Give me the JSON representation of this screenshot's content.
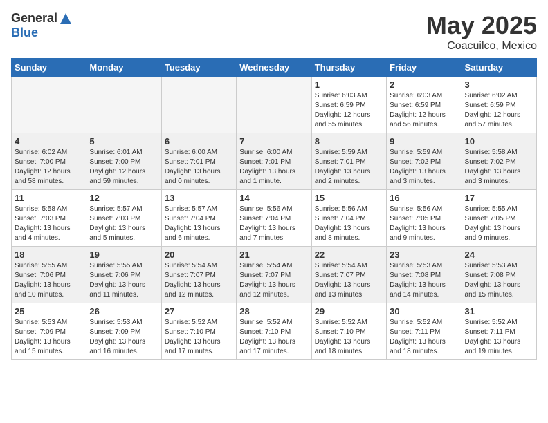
{
  "header": {
    "logo_general": "General",
    "logo_blue": "Blue",
    "month_year": "May 2025",
    "location": "Coacuilco, Mexico"
  },
  "days_of_week": [
    "Sunday",
    "Monday",
    "Tuesday",
    "Wednesday",
    "Thursday",
    "Friday",
    "Saturday"
  ],
  "weeks": [
    [
      {
        "day": "",
        "info": ""
      },
      {
        "day": "",
        "info": ""
      },
      {
        "day": "",
        "info": ""
      },
      {
        "day": "",
        "info": ""
      },
      {
        "day": "1",
        "info": "Sunrise: 6:03 AM\nSunset: 6:59 PM\nDaylight: 12 hours and 55 minutes."
      },
      {
        "day": "2",
        "info": "Sunrise: 6:03 AM\nSunset: 6:59 PM\nDaylight: 12 hours and 56 minutes."
      },
      {
        "day": "3",
        "info": "Sunrise: 6:02 AM\nSunset: 6:59 PM\nDaylight: 12 hours and 57 minutes."
      }
    ],
    [
      {
        "day": "4",
        "info": "Sunrise: 6:02 AM\nSunset: 7:00 PM\nDaylight: 12 hours and 58 minutes."
      },
      {
        "day": "5",
        "info": "Sunrise: 6:01 AM\nSunset: 7:00 PM\nDaylight: 12 hours and 59 minutes."
      },
      {
        "day": "6",
        "info": "Sunrise: 6:00 AM\nSunset: 7:01 PM\nDaylight: 13 hours and 0 minutes."
      },
      {
        "day": "7",
        "info": "Sunrise: 6:00 AM\nSunset: 7:01 PM\nDaylight: 13 hours and 1 minute."
      },
      {
        "day": "8",
        "info": "Sunrise: 5:59 AM\nSunset: 7:01 PM\nDaylight: 13 hours and 2 minutes."
      },
      {
        "day": "9",
        "info": "Sunrise: 5:59 AM\nSunset: 7:02 PM\nDaylight: 13 hours and 3 minutes."
      },
      {
        "day": "10",
        "info": "Sunrise: 5:58 AM\nSunset: 7:02 PM\nDaylight: 13 hours and 3 minutes."
      }
    ],
    [
      {
        "day": "11",
        "info": "Sunrise: 5:58 AM\nSunset: 7:03 PM\nDaylight: 13 hours and 4 minutes."
      },
      {
        "day": "12",
        "info": "Sunrise: 5:57 AM\nSunset: 7:03 PM\nDaylight: 13 hours and 5 minutes."
      },
      {
        "day": "13",
        "info": "Sunrise: 5:57 AM\nSunset: 7:04 PM\nDaylight: 13 hours and 6 minutes."
      },
      {
        "day": "14",
        "info": "Sunrise: 5:56 AM\nSunset: 7:04 PM\nDaylight: 13 hours and 7 minutes."
      },
      {
        "day": "15",
        "info": "Sunrise: 5:56 AM\nSunset: 7:04 PM\nDaylight: 13 hours and 8 minutes."
      },
      {
        "day": "16",
        "info": "Sunrise: 5:56 AM\nSunset: 7:05 PM\nDaylight: 13 hours and 9 minutes."
      },
      {
        "day": "17",
        "info": "Sunrise: 5:55 AM\nSunset: 7:05 PM\nDaylight: 13 hours and 9 minutes."
      }
    ],
    [
      {
        "day": "18",
        "info": "Sunrise: 5:55 AM\nSunset: 7:06 PM\nDaylight: 13 hours and 10 minutes."
      },
      {
        "day": "19",
        "info": "Sunrise: 5:55 AM\nSunset: 7:06 PM\nDaylight: 13 hours and 11 minutes."
      },
      {
        "day": "20",
        "info": "Sunrise: 5:54 AM\nSunset: 7:07 PM\nDaylight: 13 hours and 12 minutes."
      },
      {
        "day": "21",
        "info": "Sunrise: 5:54 AM\nSunset: 7:07 PM\nDaylight: 13 hours and 12 minutes."
      },
      {
        "day": "22",
        "info": "Sunrise: 5:54 AM\nSunset: 7:07 PM\nDaylight: 13 hours and 13 minutes."
      },
      {
        "day": "23",
        "info": "Sunrise: 5:53 AM\nSunset: 7:08 PM\nDaylight: 13 hours and 14 minutes."
      },
      {
        "day": "24",
        "info": "Sunrise: 5:53 AM\nSunset: 7:08 PM\nDaylight: 13 hours and 15 minutes."
      }
    ],
    [
      {
        "day": "25",
        "info": "Sunrise: 5:53 AM\nSunset: 7:09 PM\nDaylight: 13 hours and 15 minutes."
      },
      {
        "day": "26",
        "info": "Sunrise: 5:53 AM\nSunset: 7:09 PM\nDaylight: 13 hours and 16 minutes."
      },
      {
        "day": "27",
        "info": "Sunrise: 5:52 AM\nSunset: 7:10 PM\nDaylight: 13 hours and 17 minutes."
      },
      {
        "day": "28",
        "info": "Sunrise: 5:52 AM\nSunset: 7:10 PM\nDaylight: 13 hours and 17 minutes."
      },
      {
        "day": "29",
        "info": "Sunrise: 5:52 AM\nSunset: 7:10 PM\nDaylight: 13 hours and 18 minutes."
      },
      {
        "day": "30",
        "info": "Sunrise: 5:52 AM\nSunset: 7:11 PM\nDaylight: 13 hours and 18 minutes."
      },
      {
        "day": "31",
        "info": "Sunrise: 5:52 AM\nSunset: 7:11 PM\nDaylight: 13 hours and 19 minutes."
      }
    ]
  ]
}
